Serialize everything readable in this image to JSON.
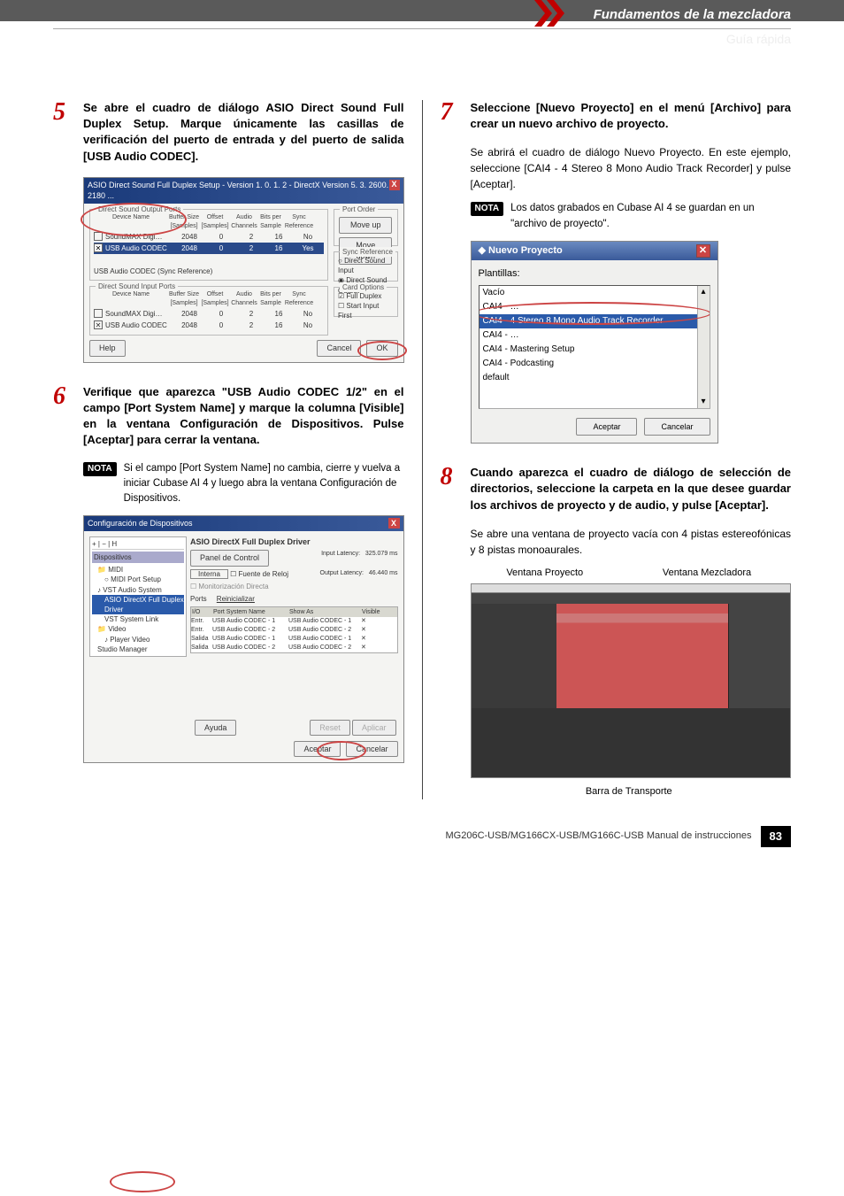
{
  "header": {
    "section": "Fundamentos de la mezcladora",
    "guide": "Guía rápida"
  },
  "left": {
    "step5": {
      "num": "5",
      "body": "Se abre el cuadro de diálogo ASIO Direct Sound Full Duplex Setup. Marque únicamente las casillas de verificación del puerto de entrada y del puerto de salida [USB Audio CODEC]."
    },
    "fig1": {
      "title": "ASIO Direct Sound Full Duplex Setup  -  Version 1. 0. 1. 2  -  DirectX Version 5. 3. 2600. 2180  ...",
      "outputPorts": {
        "legend": "Direct Sound Output Ports",
        "headers": {
          "dev": "Device Name",
          "buf": "Buffer Size [Samples]",
          "off": "Offset [Samples]",
          "aud": "Audio Channels",
          "bits": "Bits per Sample",
          "sync": "Sync Reference"
        },
        "rows": [
          {
            "name": "SoundMAX Digi…",
            "buf": "2048",
            "off": "0",
            "aud": "2",
            "bits": "16",
            "sync": "No",
            "checked": false
          },
          {
            "name": "USB Audio CODEC",
            "buf": "2048",
            "off": "0",
            "aud": "2",
            "bits": "16",
            "sync": "Yes",
            "checked": true,
            "selected": true
          }
        ],
        "footnote": "USB Audio CODEC   (Sync Reference)"
      },
      "inputPorts": {
        "legend": "Direct Sound Input Ports",
        "rows": [
          {
            "name": "SoundMAX Digi…",
            "buf": "2048",
            "off": "0",
            "aud": "2",
            "bits": "16",
            "sync": "No",
            "checked": false
          },
          {
            "name": "USB Audio CODEC",
            "buf": "2048",
            "off": "0",
            "aud": "2",
            "bits": "16",
            "sync": "No",
            "checked": true
          }
        ]
      },
      "side": {
        "portOrder": "Port Order",
        "moveUp": "Move up",
        "moveDown": "Move down",
        "syncRef": "Sync Reference",
        "dsInput": "Direct Sound Input",
        "dsOutput": "Direct Sound Output",
        "cardOpt": "Card Options",
        "fullDuplex": "Full Duplex",
        "startInputFirst": "Start Input First"
      },
      "buttons": {
        "help": "Help",
        "cancel": "Cancel",
        "ok": "OK"
      }
    },
    "step6": {
      "num": "6",
      "body": "Verifique que aparezca \"USB Audio CODEC 1/2\" en el campo [Port System Name] y marque la columna [Visible] en la ventana Configuración de Dispositivos. Pulse [Aceptar] para cerrar la ventana.",
      "notaLabel": "NOTA",
      "nota": "Si el campo [Port System Name] no cambia, cierre y vuelva a iniciar Cubase AI 4 y luego abra la ventana Configuración de Dispositivos."
    },
    "fig2": {
      "title": "Configuración de Dispositivos",
      "driver": "ASIO DirectX Full Duplex Driver",
      "panelControl": "Panel de Control",
      "internal": "Interna",
      "externalClock": "Fuente de Reloj",
      "directMon": "Monitorización Directa",
      "ports": "Ports",
      "reset": "Reinicializar",
      "latencyIn": "Input Latency:",
      "latencyInVal": "325.079 ms",
      "latencyOut": "Output Latency:",
      "latencyOutVal": "46.440 ms",
      "tree": [
        "MIDI",
        "MIDI Port Setup",
        "VST Audio System",
        "ASIO DirectX Full Duplex Driver",
        "VST System Link",
        "Video",
        "Player Video",
        "Studio Manager"
      ],
      "tableHeaders": {
        "io": "I/O",
        "port": "Port System Name",
        "show": "Show As",
        "vis": "Visible"
      },
      "rows": [
        {
          "io": "Entr.",
          "port": "USB Audio CODEC - 1",
          "show": "USB Audio CODEC - 1"
        },
        {
          "io": "Entr.",
          "port": "USB Audio CODEC - 2",
          "show": "USB Audio CODEC - 2"
        },
        {
          "io": "Salida",
          "port": "USB Audio CODEC - 1",
          "show": "USB Audio CODEC - 1"
        },
        {
          "io": "Salida",
          "port": "USB Audio CODEC - 2",
          "show": "USB Audio CODEC - 2"
        }
      ],
      "help": "Ayuda",
      "reset2": "Reset",
      "apply": "Aplicar",
      "accept": "Aceptar",
      "cancel": "Cancelar"
    }
  },
  "right": {
    "step7": {
      "num": "7",
      "body": "Seleccione [Nuevo Proyecto] en el menú [Archivo] para crear un nuevo archivo de proyecto.",
      "desc": "Se abrirá el cuadro de diálogo Nuevo Proyecto. En este ejemplo, seleccione [CAI4 - 4 Stereo 8 Mono Audio Track Recorder] y pulse [Aceptar].",
      "notaLabel": "NOTA",
      "nota": "Los datos grabados en Cubase AI 4 se guardan en un \"archivo de proyecto\"."
    },
    "np": {
      "title": "Nuevo Proyecto",
      "templates": "Plantillas:",
      "items": [
        "Vacío",
        "CAI4 - …",
        "CAI4 - 4 Stereo 8 Mono Audio Track Recorder",
        "CAI4 - …",
        "CAI4 - Mastering Setup",
        "CAI4 - Podcasting",
        "default"
      ],
      "accept": "Aceptar",
      "cancel": "Cancelar"
    },
    "step8": {
      "num": "8",
      "body": "Cuando aparezca el cuadro de diálogo de selección de directorios, seleccione la carpeta en la que desee guardar los archivos de proyecto y de audio, y pulse [Aceptar].",
      "desc": "Se abre una ventana de proyecto vacía con 4 pistas estereofónicas y 8 pistas monoaurales."
    },
    "captions": {
      "project": "Ventana Proyecto",
      "mixer": "Ventana Mezcladora",
      "transport": "Barra de Transporte"
    }
  },
  "footer": {
    "text": "MG206C-USB/MG166CX-USB/MG166C-USB   Manual de instrucciones",
    "page": "83"
  }
}
